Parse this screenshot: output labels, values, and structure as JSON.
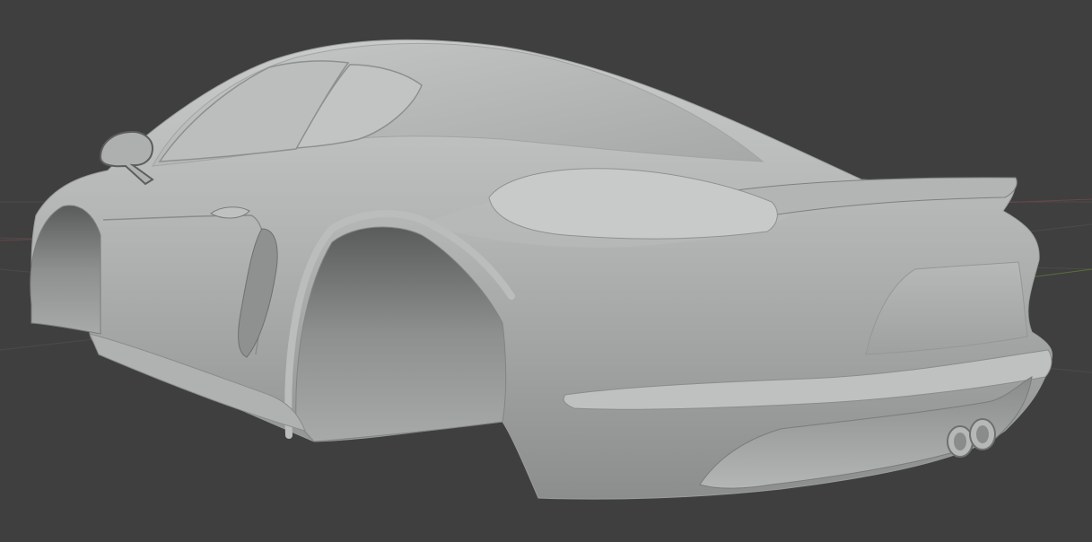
{
  "viewport": {
    "background_color": "#3f3f3f",
    "grid_color": "#4a4a4a",
    "axis_x_color": "#7a4a4a",
    "axis_y_color": "#5c7a3a",
    "model_color": "#a9abab"
  }
}
